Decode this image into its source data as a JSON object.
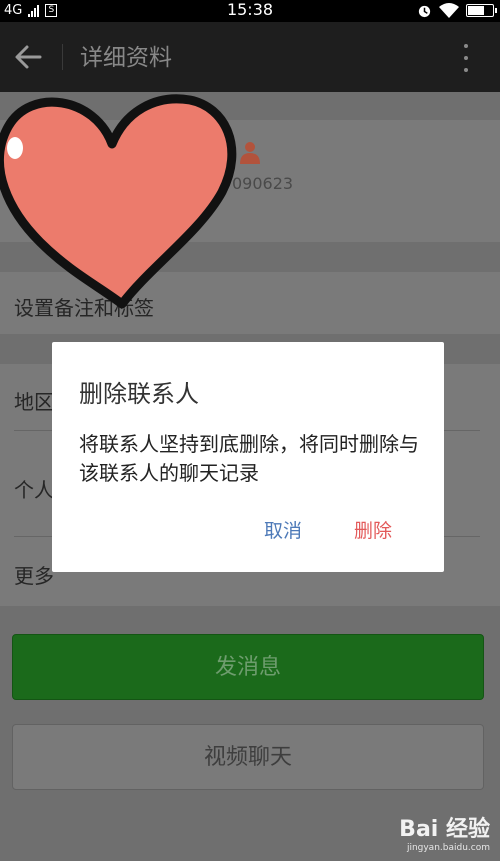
{
  "status_bar": {
    "network": "4G",
    "sim_icon": "sim-card-icon",
    "time": "15:38",
    "icons": [
      "alarm-icon",
      "wifi-icon",
      "battery-icon"
    ],
    "battery_level": 0.7
  },
  "header": {
    "title": "详细资料"
  },
  "profile": {
    "wechat_id_partial": "090623"
  },
  "rows": {
    "remark_tags": "设置备注和标签",
    "region": "地区",
    "personal": "个人",
    "more": "更多"
  },
  "buttons": {
    "send_message": "发消息",
    "video_chat": "视频聊天"
  },
  "dialog": {
    "title": "删除联系人",
    "message": "将联系人坚持到底删除，将同时删除与该联系人的聊天记录",
    "cancel": "取消",
    "confirm": "删除"
  },
  "watermark": {
    "logo": "Bai 经验",
    "url": "jingyan.baidu.com"
  },
  "colors": {
    "send_button": "#1b6a1b",
    "cancel": "#4e7ab8",
    "delete": "#e35a5a",
    "heart": "#ec7b6c"
  }
}
